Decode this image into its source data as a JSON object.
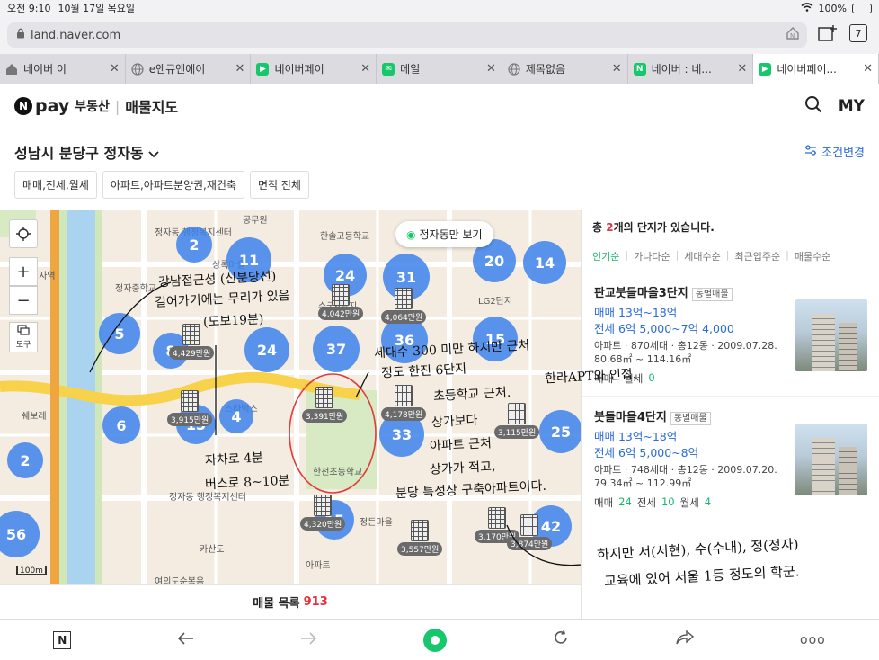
{
  "status": {
    "time": "오전 9:10",
    "date": "10월 17일 목요일",
    "battery": "100%"
  },
  "browser": {
    "url": "land.naver.com",
    "tab_count": "7",
    "tabs": [
      {
        "label": "네이버 이",
        "icon": "home-icon"
      },
      {
        "label": "e엔큐엔에이",
        "icon": "globe-icon"
      },
      {
        "label": "네이버페이",
        "icon": "naverpay-icon"
      },
      {
        "label": "메일",
        "icon": "mail-icon"
      },
      {
        "label": "제목없음",
        "icon": "globe-icon"
      },
      {
        "label": "네이버 : 네...",
        "icon": "naver-icon"
      },
      {
        "label": "네이버페이...",
        "icon": "naverpay-icon"
      }
    ]
  },
  "header": {
    "logo_letter": "N",
    "logo_pay": "pay",
    "sub": "부동산",
    "title": "매물지도",
    "my": "MY"
  },
  "region": {
    "name": "성남시 분당구 정자동",
    "filter_label": "조건변경"
  },
  "filters": [
    "매매,전세,월세",
    "아파트,아파트분양권,재건축",
    "면적 전체"
  ],
  "map": {
    "only_button": "정자동만 보기",
    "tool_label": "도구",
    "scale": "100m",
    "clusters": [
      "2",
      "11",
      "24",
      "31",
      "20",
      "14",
      "5",
      "8",
      "24",
      "37",
      "36",
      "15",
      "6",
      "4",
      "13",
      "33",
      "25",
      "2",
      "56",
      "15",
      "42"
    ],
    "prices": [
      "4,042만원",
      "4,064만원",
      "4,429만원",
      "3,915만원",
      "3,391만원",
      "4,178만원",
      "3,115만원",
      "4,320만원",
      "3,557만원",
      "3,170만원",
      "3,874만원"
    ],
    "labels": [
      "정자동 행정복지센터",
      "공무원",
      "상록마을",
      "정자중학교",
      "한솔고등학교",
      "정자역",
      "스타벅스",
      "쉐보레",
      "한천초등학교",
      "정든마을",
      "LG2단지",
      "카산도",
      "여의도순복음",
      "정자동 행정복지센터",
      "아파트",
      "수궁6단지"
    ]
  },
  "list": {
    "label": "매물 목록",
    "count": "913"
  },
  "panel": {
    "head_prefix": "총 ",
    "head_count": "2",
    "head_suffix": "개의 단지가 있습니다.",
    "sorts": [
      "인기순",
      "가나다순",
      "세대수순",
      "최근입주순",
      "매물수순"
    ],
    "items": [
      {
        "name": "판교붓들마을3단지",
        "tag": "동별매물",
        "sale": "매매 13억~18억",
        "jeonse": "전세 6억 5,000~7억 4,000",
        "info": "아파트 · 870세대 · 총12동 · 2009.07.28.",
        "area": "80.68㎡ ~ 114.16㎡",
        "counts": [
          "매매",
          "",
          "월세",
          "0"
        ]
      },
      {
        "name": "붓들마을4단지",
        "tag": "동별매물",
        "sale": "매매 13억~18억",
        "jeonse": "전세 6억 5,000~8억",
        "info": "아파트 · 748세대 · 총12동 · 2009.07.20.",
        "area": "79.34㎡ ~ 112.99㎡",
        "counts": [
          "매매",
          "24",
          "전세",
          "10",
          "월세",
          "4"
        ]
      }
    ]
  },
  "annotations": [
    "강남접근성 (신분당선)",
    "걸어가기에는 무리가 있음",
    "(도보19분)",
    "자차로 4분",
    "버스로 8~10분",
    "세대수 300 미만 하지만 근처",
    "한라APT와 인접.",
    "정도 한진 6단지",
    "초등학교 근처.",
    "상가보다",
    "아파트 근처",
    "상가가 적고,",
    "분당 특성상 구축아파트이다.",
    "하지만 서(서현), 수(수내), 정(정자)",
    "교육에 있어 서울 1등 정도의 학군."
  ],
  "colors": {
    "cluster": "#3c82eb",
    "accent_green": "#16c86b",
    "link_blue": "#2a6bd6",
    "count_red": "#e8303a",
    "highway": "#f7d24a"
  }
}
